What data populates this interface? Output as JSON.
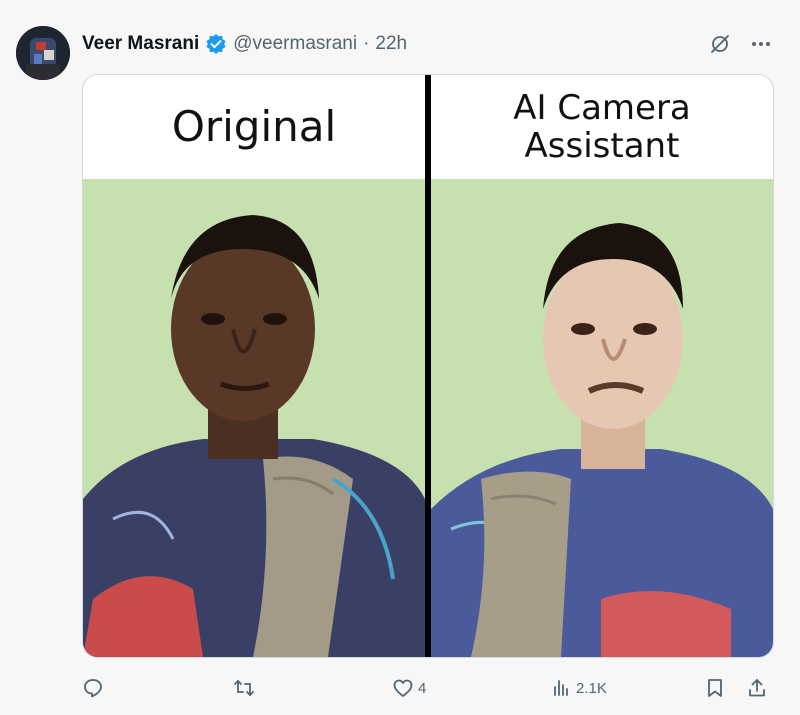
{
  "post": {
    "author_name": "Veer Masrani",
    "author_handle": "@veermasrani",
    "separator": "·",
    "timestamp": "22h"
  },
  "media": {
    "left_caption": "Original",
    "right_caption_line1": "AI Camera",
    "right_caption_line2": "Assistant"
  },
  "metrics": {
    "likes": "4",
    "views": "2.1K"
  },
  "colors": {
    "verified_blue": "#1d9bf0",
    "backdrop_green": "#c7e0b0",
    "muted_text": "#536471"
  },
  "icons": {
    "reply": "reply-icon",
    "repost": "repost-icon",
    "like": "heart-icon",
    "views": "views-icon",
    "bookmark": "bookmark-icon",
    "share": "share-icon",
    "grok": "grok-icon",
    "more": "more-icon",
    "verified": "verified-badge-icon"
  }
}
